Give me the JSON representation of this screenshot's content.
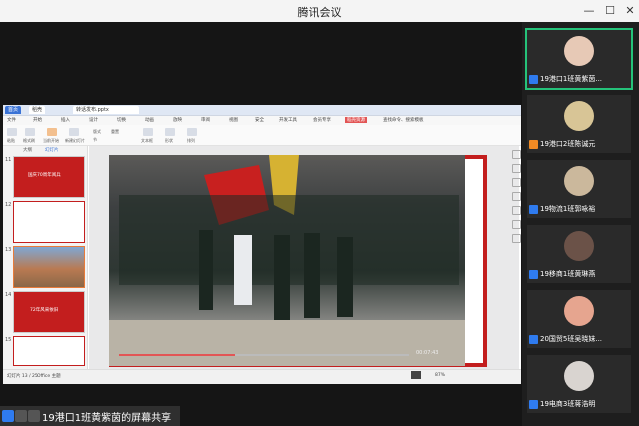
{
  "app": {
    "title": "腾讯会议"
  },
  "wps": {
    "tabs": [
      "首页",
      "稻壳",
      "转话发布.pptx"
    ],
    "menu": [
      "文件",
      "开始",
      "插入",
      "设计",
      "切换",
      "动画",
      "放映",
      "审阅",
      "视图",
      "安全",
      "开发工具",
      "会员专享",
      "稻壳资源",
      "查找命令、搜索模板"
    ],
    "ribbon_labels": [
      "粘贴",
      "格式刷",
      "当前开始",
      "新建幻灯片",
      "版式",
      "节",
      "重置",
      "文本框",
      "形状",
      "排列"
    ],
    "thumbs_header": [
      "大纲",
      "幻灯片"
    ],
    "thumb_nums": [
      "11",
      "12",
      "13",
      "14",
      "15"
    ],
    "thumb_titles": [
      "国庆70周年阅兵",
      "",
      "",
      "72年风采依旧",
      ""
    ],
    "video_time": "00:07:43",
    "status": {
      "slide": "幻灯片 13 / 25",
      "theme": "Office 主题",
      "zoom": "87%"
    }
  },
  "share": {
    "label": "19港口1班黄紫茵的屏幕共享"
  },
  "participants": [
    {
      "name": "19港口1班黄紫茵...",
      "active": true
    },
    {
      "name": "19港口2班陈诚元",
      "active": false
    },
    {
      "name": "19物流1班郭咏裕",
      "active": false
    },
    {
      "name": "19移商1班黄琳燕",
      "active": false
    },
    {
      "name": "20国贸5班吴晓妹...",
      "active": false
    },
    {
      "name": "19电商3班蒋浩明",
      "active": false
    }
  ]
}
